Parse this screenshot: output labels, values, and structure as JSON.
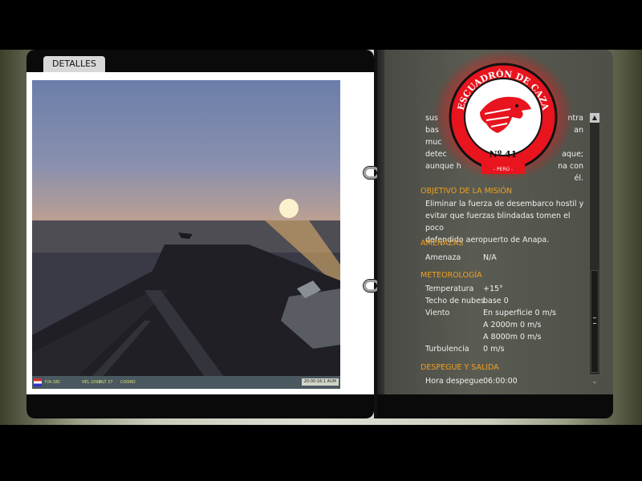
{
  "tab": {
    "label": "DETALLES"
  },
  "photo_hud": {
    "aircraft": "F/A-18C",
    "vel": "VEL 1098",
    "alt": "ALT 37",
    "coord": "COORD",
    "time": "20:00:16:1 AUM"
  },
  "briefing": {
    "intro_lines": [
      "sus",
      "bas",
      "muc",
      "detec",
      "aunque h"
    ],
    "intro_right_lines": [
      "ntra",
      "an",
      "",
      "aque;",
      "na con él."
    ],
    "objective": {
      "title": "OBJETIVO DE LA MISIÓN",
      "lines": [
        "Eliminar la fuerza de desembarco hostil y",
        "evitar que fuerzas blindadas tomen el poco",
        "defendido aeropuerto de Anapa."
      ]
    },
    "threats": {
      "title": "AMENAZAS",
      "label": "Amenaza",
      "value": "N/A"
    },
    "weather": {
      "title": "METEOROLOGÍA",
      "temp_label": "Temperatura",
      "temp_value": "+15°",
      "ceiling_label": "Techo de nubes",
      "ceiling_value": "base 0",
      "wind_label": "Viento",
      "wind_surface": "En superficie 0 m/s",
      "wind_2000": "A 2000m 0 m/s",
      "wind_8000": "A 8000m 0 m/s",
      "turb_label": "Turbulencia",
      "turb_value": "0 m/s"
    },
    "takeoff": {
      "title": "DESPEGUE Y SALIDA",
      "label": "Hora despegue",
      "value": "06:00:00"
    }
  },
  "logo": {
    "top_text": "ESCUADRÓN DE CAZA",
    "number": "Nº 41",
    "country": "- PERÚ -",
    "colors": {
      "red": "#e8141e",
      "black": "#111111",
      "white": "#ffffff"
    }
  },
  "scroll": {
    "up_icon": "▲",
    "down_icon": "⌄"
  }
}
